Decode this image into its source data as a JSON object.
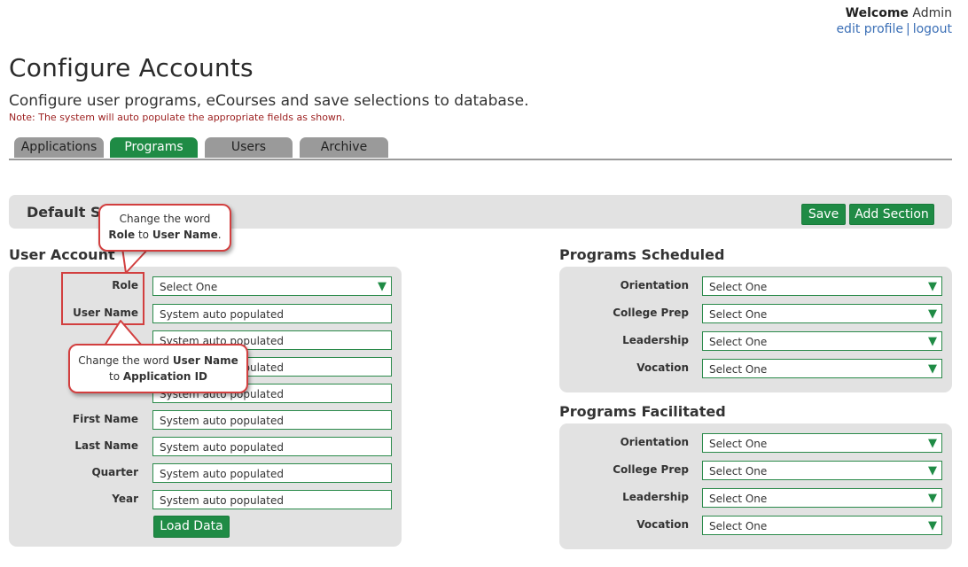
{
  "header": {
    "welcome_bold": "Welcome",
    "welcome_user": "Admin",
    "edit_profile": "edit profile",
    "separator": "|",
    "logout": "logout"
  },
  "page": {
    "title": "Configure Accounts",
    "subtitle": "Configure user programs, eCourses and save selections to database.",
    "note": "Note: The system will auto populate the appropriate fields as shown."
  },
  "tabs": [
    {
      "label": "Applications",
      "active": false
    },
    {
      "label": "Programs",
      "active": true
    },
    {
      "label": "Users",
      "active": false
    },
    {
      "label": "Archive",
      "active": false
    }
  ],
  "section": {
    "title": "Default Set",
    "save_label": "Save",
    "add_section_label": "Add Section"
  },
  "user_account": {
    "title": "User Account",
    "role_label": "Role",
    "role_value": "Select One",
    "fields": [
      {
        "label": "User Name",
        "value": "System auto populated"
      },
      {
        "label": "",
        "value": "System auto populated"
      },
      {
        "label": "",
        "value": "System auto populated"
      },
      {
        "label": "",
        "value": "System auto populated"
      },
      {
        "label": "First Name",
        "value": "System auto populated"
      },
      {
        "label": "Last Name",
        "value": "System auto populated"
      },
      {
        "label": "Quarter",
        "value": "System auto populated"
      },
      {
        "label": "Year",
        "value": "System auto populated"
      }
    ],
    "load_label": "Load Data"
  },
  "programs_scheduled": {
    "title": "Programs Scheduled",
    "rows": [
      {
        "label": "Orientation",
        "value": "Select One"
      },
      {
        "label": "College Prep",
        "value": "Select One"
      },
      {
        "label": "Leadership",
        "value": "Select One"
      },
      {
        "label": "Vocation",
        "value": "Select One"
      }
    ]
  },
  "programs_facilitated": {
    "title": "Programs Facilitated",
    "rows": [
      {
        "label": "Orientation",
        "value": "Select One"
      },
      {
        "label": "College Prep",
        "value": "Select One"
      },
      {
        "label": "Leadership",
        "value": "Select One"
      },
      {
        "label": "Vocation",
        "value": "Select One"
      }
    ]
  },
  "callouts": {
    "first": {
      "line1": "Change the word",
      "bold_a": "Role",
      "mid": " to ",
      "bold_b": "User Name",
      "end": "."
    },
    "second": {
      "line1": "Change the word ",
      "bold_a": "User Name",
      "mid": "to ",
      "bold_b": "Application ID"
    }
  },
  "colors": {
    "accent_green": "#1f8b45",
    "tab_gray": "#9a9a9a",
    "callout_red": "#d23f3f",
    "note_red": "#9b1d1d"
  },
  "icons": {
    "dropdown_arrow": "▼"
  }
}
